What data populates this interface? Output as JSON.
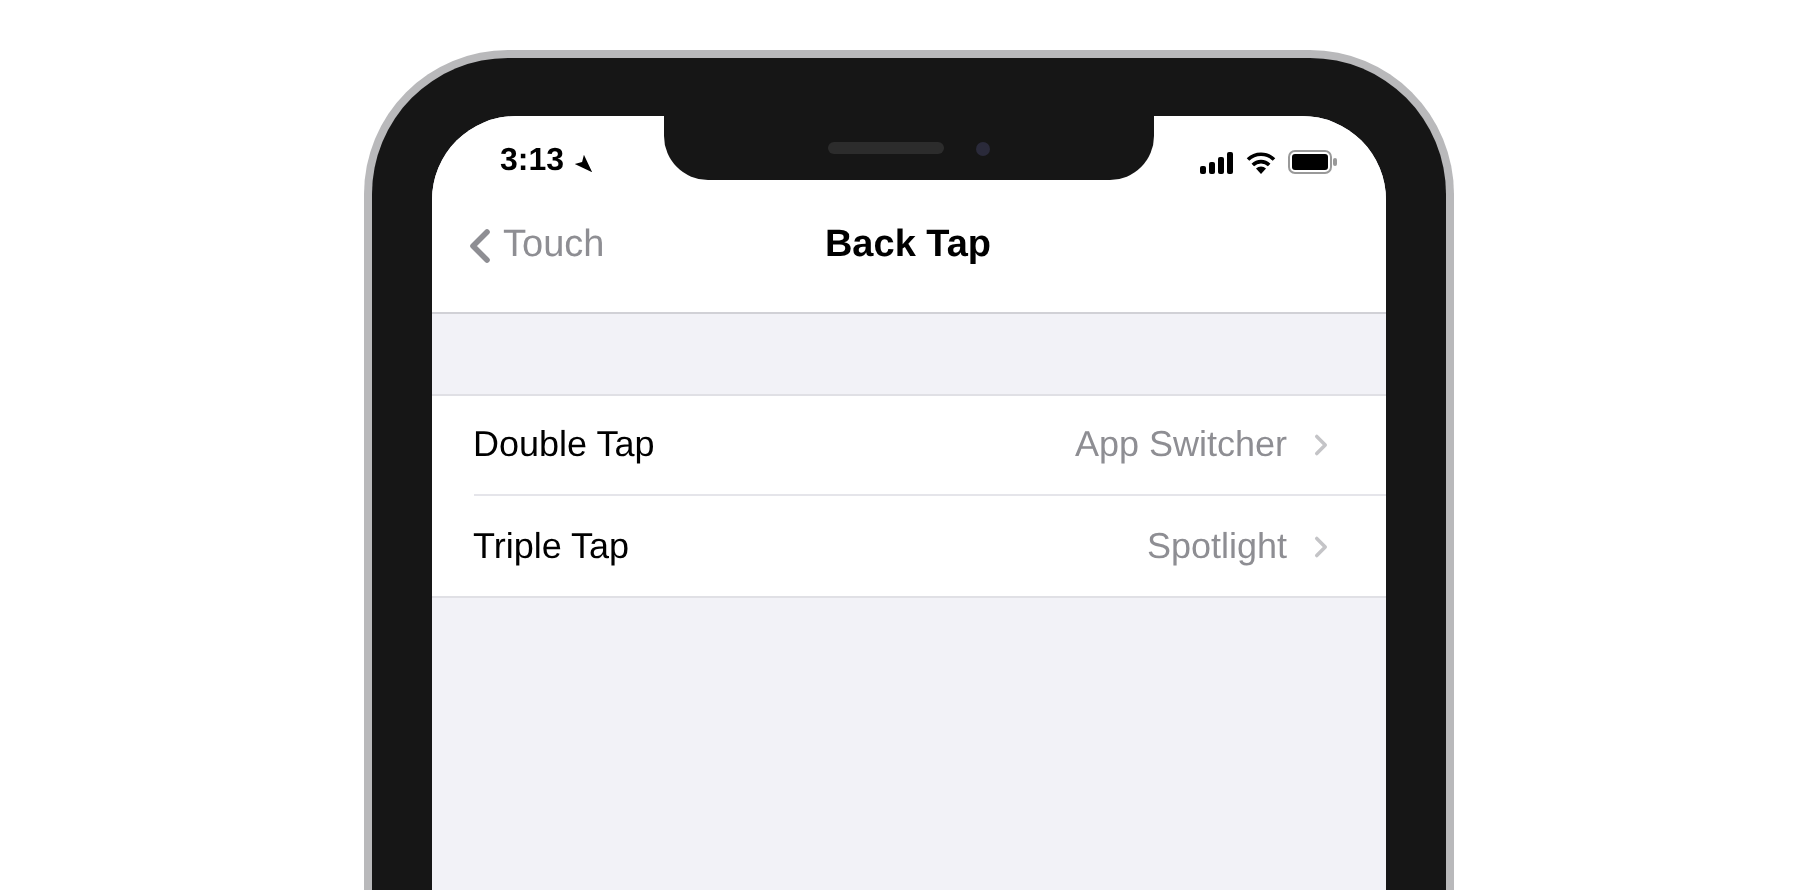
{
  "status_bar": {
    "time": "3:13"
  },
  "nav": {
    "back_label": "Touch",
    "title": "Back Tap"
  },
  "rows": [
    {
      "label": "Double Tap",
      "value": "App Switcher"
    },
    {
      "label": "Triple Tap",
      "value": "Spotlight"
    }
  ]
}
